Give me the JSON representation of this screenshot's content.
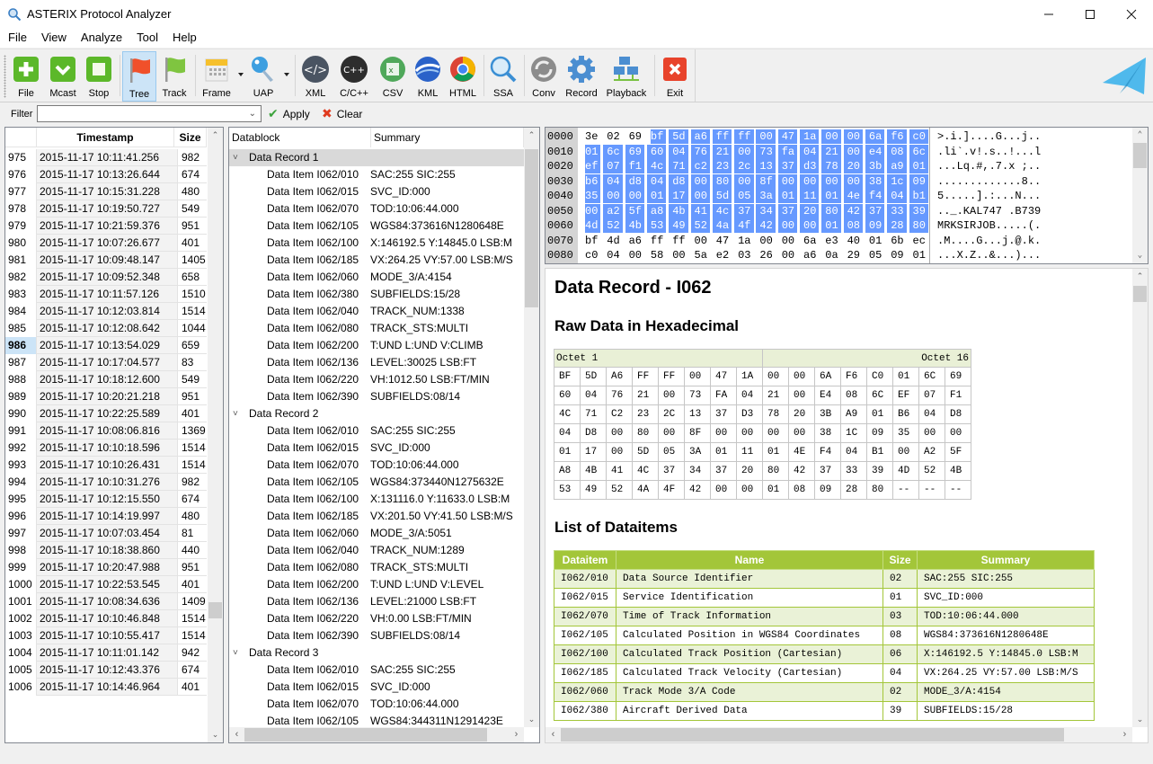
{
  "window": {
    "title": "ASTERIX Protocol Analyzer",
    "controls": [
      "minimize",
      "maximize",
      "close"
    ]
  },
  "menu": [
    "File",
    "View",
    "Analyze",
    "Tool",
    "Help"
  ],
  "toolbar": {
    "buttons": [
      {
        "label": "File",
        "icon": "add-file-icon"
      },
      {
        "label": "Mcast",
        "icon": "check-icon"
      },
      {
        "label": "Stop",
        "icon": "stop-icon"
      },
      {
        "label": "Tree",
        "icon": "red-flag-icon",
        "active": true
      },
      {
        "label": "Track",
        "icon": "green-flag-icon"
      },
      {
        "label": "Frame",
        "icon": "calendar-icon",
        "dropdown": true
      },
      {
        "label": "UAP",
        "icon": "key-icon",
        "dropdown": true
      },
      {
        "label": "XML",
        "icon": "code-icon"
      },
      {
        "label": "C/C++",
        "icon": "cpp-icon"
      },
      {
        "label": "CSV",
        "icon": "excel-icon"
      },
      {
        "label": "KML",
        "icon": "earth-icon"
      },
      {
        "label": "HTML",
        "icon": "browser-icon"
      },
      {
        "label": "SSA",
        "icon": "magnifier-icon"
      },
      {
        "label": "Conv",
        "icon": "convert-icon"
      },
      {
        "label": "Record",
        "icon": "gear-icon"
      },
      {
        "label": "Playback",
        "icon": "network-icon"
      },
      {
        "label": "Exit",
        "icon": "exit-icon"
      }
    ],
    "logo": "paper-plane-icon"
  },
  "filter": {
    "label": "Filter",
    "value": "",
    "apply_label": "Apply",
    "clear_label": "Clear"
  },
  "packets": {
    "headers": [
      "",
      "Timestamp",
      "Size"
    ],
    "selected": "986",
    "rows": [
      [
        "975",
        "2015-11-17 10:11:41.256",
        "982"
      ],
      [
        "976",
        "2015-11-17 10:13:26.644",
        "674"
      ],
      [
        "977",
        "2015-11-17 10:15:31.228",
        "480"
      ],
      [
        "978",
        "2015-11-17 10:19:50.727",
        "549"
      ],
      [
        "979",
        "2015-11-17 10:21:59.376",
        "951"
      ],
      [
        "980",
        "2015-11-17 10:07:26.677",
        "401"
      ],
      [
        "981",
        "2015-11-17 10:09:48.147",
        "1405"
      ],
      [
        "982",
        "2015-11-17 10:09:52.348",
        "658"
      ],
      [
        "983",
        "2015-11-17 10:11:57.126",
        "1510"
      ],
      [
        "984",
        "2015-11-17 10:12:03.814",
        "1514"
      ],
      [
        "985",
        "2015-11-17 10:12:08.642",
        "1044"
      ],
      [
        "986",
        "2015-11-17 10:13:54.029",
        "659"
      ],
      [
        "987",
        "2015-11-17 10:17:04.577",
        "83"
      ],
      [
        "988",
        "2015-11-17 10:18:12.600",
        "549"
      ],
      [
        "989",
        "2015-11-17 10:20:21.218",
        "951"
      ],
      [
        "990",
        "2015-11-17 10:22:25.589",
        "401"
      ],
      [
        "991",
        "2015-11-17 10:08:06.816",
        "1369"
      ],
      [
        "992",
        "2015-11-17 10:10:18.596",
        "1514"
      ],
      [
        "993",
        "2015-11-17 10:10:26.431",
        "1514"
      ],
      [
        "994",
        "2015-11-17 10:10:31.276",
        "982"
      ],
      [
        "995",
        "2015-11-17 10:12:15.550",
        "674"
      ],
      [
        "996",
        "2015-11-17 10:14:19.997",
        "480"
      ],
      [
        "997",
        "2015-11-17 10:07:03.454",
        "81"
      ],
      [
        "998",
        "2015-11-17 10:18:38.860",
        "440"
      ],
      [
        "999",
        "2015-11-17 10:20:47.988",
        "951"
      ],
      [
        "1000",
        "2015-11-17 10:22:53.545",
        "401"
      ],
      [
        "1001",
        "2015-11-17 10:08:34.636",
        "1409"
      ],
      [
        "1002",
        "2015-11-17 10:10:46.848",
        "1514"
      ],
      [
        "1003",
        "2015-11-17 10:10:55.417",
        "1514"
      ],
      [
        "1004",
        "2015-11-17 10:11:01.142",
        "942"
      ],
      [
        "1005",
        "2015-11-17 10:12:43.376",
        "674"
      ],
      [
        "1006",
        "2015-11-17 10:14:46.964",
        "401"
      ]
    ]
  },
  "tree": {
    "headers": [
      "Datablock",
      "Summary"
    ],
    "rows": [
      {
        "type": "rec",
        "label": "Data Record 1",
        "selected": true
      },
      {
        "type": "item",
        "label": "Data Item I062/010",
        "summary": "SAC:255 SIC:255"
      },
      {
        "type": "item",
        "label": "Data Item I062/015",
        "summary": "SVC_ID:000"
      },
      {
        "type": "item",
        "label": "Data Item I062/070",
        "summary": "TOD:10:06:44.000"
      },
      {
        "type": "item",
        "label": "Data Item I062/105",
        "summary": "WGS84:373616N1280648E"
      },
      {
        "type": "item",
        "label": "Data Item I062/100",
        "summary": "X:146192.5 Y:14845.0 LSB:M"
      },
      {
        "type": "item",
        "label": "Data Item I062/185",
        "summary": "VX:264.25 VY:57.00 LSB:M/S"
      },
      {
        "type": "item",
        "label": "Data Item I062/060",
        "summary": "MODE_3/A:4154"
      },
      {
        "type": "item",
        "label": "Data Item I062/380",
        "summary": "SUBFIELDS:15/28"
      },
      {
        "type": "item",
        "label": "Data Item I062/040",
        "summary": "TRACK_NUM:1338"
      },
      {
        "type": "item",
        "label": "Data Item I062/080",
        "summary": "TRACK_STS:MULTI"
      },
      {
        "type": "item",
        "label": "Data Item I062/200",
        "summary": "T:UND L:UND V:CLIMB"
      },
      {
        "type": "item",
        "label": "Data Item I062/136",
        "summary": "LEVEL:30025 LSB:FT"
      },
      {
        "type": "item",
        "label": "Data Item I062/220",
        "summary": "VH:1012.50 LSB:FT/MIN"
      },
      {
        "type": "item",
        "label": "Data Item I062/390",
        "summary": "SUBFIELDS:08/14"
      },
      {
        "type": "rec",
        "label": "Data Record 2"
      },
      {
        "type": "item",
        "label": "Data Item I062/010",
        "summary": "SAC:255 SIC:255"
      },
      {
        "type": "item",
        "label": "Data Item I062/015",
        "summary": "SVC_ID:000"
      },
      {
        "type": "item",
        "label": "Data Item I062/070",
        "summary": "TOD:10:06:44.000"
      },
      {
        "type": "item",
        "label": "Data Item I062/105",
        "summary": "WGS84:373440N1275632E"
      },
      {
        "type": "item",
        "label": "Data Item I062/100",
        "summary": "X:131116.0 Y:11633.0 LSB:M"
      },
      {
        "type": "item",
        "label": "Data Item I062/185",
        "summary": "VX:201.50 VY:41.50 LSB:M/S"
      },
      {
        "type": "item",
        "label": "Data Item I062/060",
        "summary": "MODE_3/A:5051"
      },
      {
        "type": "item",
        "label": "Data Item I062/040",
        "summary": "TRACK_NUM:1289"
      },
      {
        "type": "item",
        "label": "Data Item I062/080",
        "summary": "TRACK_STS:MULTI"
      },
      {
        "type": "item",
        "label": "Data Item I062/200",
        "summary": "T:UND L:UND V:LEVEL"
      },
      {
        "type": "item",
        "label": "Data Item I062/136",
        "summary": "LEVEL:21000 LSB:FT"
      },
      {
        "type": "item",
        "label": "Data Item I062/220",
        "summary": "VH:0.00 LSB:FT/MIN"
      },
      {
        "type": "item",
        "label": "Data Item I062/390",
        "summary": "SUBFIELDS:08/14"
      },
      {
        "type": "rec",
        "label": "Data Record 3"
      },
      {
        "type": "item",
        "label": "Data Item I062/010",
        "summary": "SAC:255 SIC:255"
      },
      {
        "type": "item",
        "label": "Data Item I062/015",
        "summary": "SVC_ID:000"
      },
      {
        "type": "item",
        "label": "Data Item I062/070",
        "summary": "TOD:10:06:44.000"
      },
      {
        "type": "item",
        "label": "Data Item I062/105",
        "summary": "WGS84:344311N1291423E"
      }
    ]
  },
  "hexdump": {
    "lines": [
      {
        "offset": "0000",
        "bytes": [
          "3e",
          "02",
          "69",
          "bf",
          "5d",
          "a6",
          "ff",
          "ff",
          "00",
          "47",
          "1a",
          "00",
          "00",
          "6a",
          "f6",
          "c0"
        ],
        "hl_from": 3,
        "ascii": ">.i.]....G...j.."
      },
      {
        "offset": "0010",
        "bytes": [
          "01",
          "6c",
          "69",
          "60",
          "04",
          "76",
          "21",
          "00",
          "73",
          "fa",
          "04",
          "21",
          "00",
          "e4",
          "08",
          "6c"
        ],
        "hl_from": 0,
        "ascii": ".li`.v!.s..!...l"
      },
      {
        "offset": "0020",
        "bytes": [
          "ef",
          "07",
          "f1",
          "4c",
          "71",
          "c2",
          "23",
          "2c",
          "13",
          "37",
          "d3",
          "78",
          "20",
          "3b",
          "a9",
          "01"
        ],
        "hl_from": 0,
        "ascii": "...Lq.#,.7.x ;.."
      },
      {
        "offset": "0030",
        "bytes": [
          "b6",
          "04",
          "d8",
          "04",
          "d8",
          "00",
          "80",
          "00",
          "8f",
          "00",
          "00",
          "00",
          "00",
          "38",
          "1c",
          "09"
        ],
        "hl_from": 0,
        "ascii": ".............8.."
      },
      {
        "offset": "0040",
        "bytes": [
          "35",
          "00",
          "00",
          "01",
          "17",
          "00",
          "5d",
          "05",
          "3a",
          "01",
          "11",
          "01",
          "4e",
          "f4",
          "04",
          "b1"
        ],
        "hl_from": 0,
        "ascii": "5.....].:...N..."
      },
      {
        "offset": "0050",
        "bytes": [
          "00",
          "a2",
          "5f",
          "a8",
          "4b",
          "41",
          "4c",
          "37",
          "34",
          "37",
          "20",
          "80",
          "42",
          "37",
          "33",
          "39"
        ],
        "hl_from": 0,
        "ascii": ".._.KAL747 .B739"
      },
      {
        "offset": "0060",
        "bytes": [
          "4d",
          "52",
          "4b",
          "53",
          "49",
          "52",
          "4a",
          "4f",
          "42",
          "00",
          "00",
          "01",
          "08",
          "09",
          "28",
          "80"
        ],
        "hl_from": 0,
        "ascii": "MRKSIRJOB.....(."
      },
      {
        "offset": "0070",
        "bytes": [
          "bf",
          "4d",
          "a6",
          "ff",
          "ff",
          "00",
          "47",
          "1a",
          "00",
          "00",
          "6a",
          "e3",
          "40",
          "01",
          "6b",
          "ec"
        ],
        "hl_from": -1,
        "ascii": ".M....G...j.@.k."
      },
      {
        "offset": "0080",
        "bytes": [
          "c0",
          "04",
          "00",
          "58",
          "00",
          "5a",
          "e2",
          "03",
          "26",
          "00",
          "a6",
          "0a",
          "29",
          "05",
          "09",
          "01"
        ],
        "hl_from": -1,
        "ascii": "...X.Z..&...)..."
      }
    ]
  },
  "report": {
    "title": "Data Record - I062",
    "raw_heading": "Raw Data in Hexadecimal",
    "octet_first": "Octet 1",
    "octet_last": "Octet 16",
    "raw_rows": [
      [
        "BF",
        "5D",
        "A6",
        "FF",
        "FF",
        "00",
        "47",
        "1A",
        "00",
        "00",
        "6A",
        "F6",
        "C0",
        "01",
        "6C",
        "69"
      ],
      [
        "60",
        "04",
        "76",
        "21",
        "00",
        "73",
        "FA",
        "04",
        "21",
        "00",
        "E4",
        "08",
        "6C",
        "EF",
        "07",
        "F1"
      ],
      [
        "4C",
        "71",
        "C2",
        "23",
        "2C",
        "13",
        "37",
        "D3",
        "78",
        "20",
        "3B",
        "A9",
        "01",
        "B6",
        "04",
        "D8"
      ],
      [
        "04",
        "D8",
        "00",
        "80",
        "00",
        "8F",
        "00",
        "00",
        "00",
        "00",
        "38",
        "1C",
        "09",
        "35",
        "00",
        "00"
      ],
      [
        "01",
        "17",
        "00",
        "5D",
        "05",
        "3A",
        "01",
        "11",
        "01",
        "4E",
        "F4",
        "04",
        "B1",
        "00",
        "A2",
        "5F"
      ],
      [
        "A8",
        "4B",
        "41",
        "4C",
        "37",
        "34",
        "37",
        "20",
        "80",
        "42",
        "37",
        "33",
        "39",
        "4D",
        "52",
        "4B"
      ],
      [
        "53",
        "49",
        "52",
        "4A",
        "4F",
        "42",
        "00",
        "00",
        "01",
        "08",
        "09",
        "28",
        "80",
        "--",
        "--",
        "--"
      ]
    ],
    "list_heading": "List of Dataitems",
    "list_headers": [
      "Dataitem",
      "Name",
      "Size",
      "Summary"
    ],
    "list_rows": [
      [
        "I062/010",
        "Data Source Identifier",
        "02",
        "SAC:255 SIC:255"
      ],
      [
        "I062/015",
        "Service Identification",
        "01",
        "SVC_ID:000"
      ],
      [
        "I062/070",
        "Time of Track Information",
        "03",
        "TOD:10:06:44.000"
      ],
      [
        "I062/105",
        "Calculated Position in WGS84 Coordinates",
        "08",
        "WGS84:373616N1280648E"
      ],
      [
        "I062/100",
        "Calculated Track Position (Cartesian)",
        "06",
        "X:146192.5 Y:14845.0 LSB:M"
      ],
      [
        "I062/185",
        "Calculated Track Velocity (Cartesian)",
        "04",
        "VX:264.25 VY:57.00 LSB:M/S"
      ],
      [
        "I062/060",
        "Track Mode 3/A Code",
        "02",
        "MODE_3/A:4154"
      ],
      [
        "I062/380",
        "Aircraft Derived Data",
        "39",
        "SUBFIELDS:15/28"
      ]
    ]
  },
  "colors": {
    "hex_highlight": "#6699ff",
    "table_header": "#a3c639",
    "selection": "#cce4f7"
  }
}
